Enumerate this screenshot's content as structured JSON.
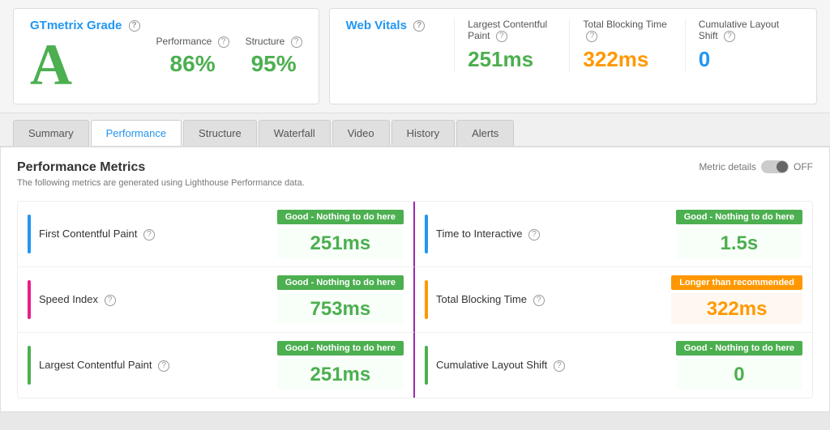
{
  "app": {
    "title": "GTmetrix"
  },
  "topSection": {
    "gradeTitle": "GTmetrix Grade",
    "gradeLetter": "A",
    "performanceLabel": "Performance",
    "performanceValue": "86%",
    "structureLabel": "Structure",
    "structureValue": "95%",
    "webVitalsTitle": "Web Vitals",
    "lcpLabel": "Largest Contentful Paint",
    "lcpValue": "251ms",
    "tbtLabel": "Total Blocking Time",
    "tbtValue": "322ms",
    "clsLabel": "Cumulative Layout Shift",
    "clsValue": "0"
  },
  "tabs": [
    {
      "label": "Summary",
      "active": false
    },
    {
      "label": "Performance",
      "active": true
    },
    {
      "label": "Structure",
      "active": false
    },
    {
      "label": "Waterfall",
      "active": false
    },
    {
      "label": "Video",
      "active": false
    },
    {
      "label": "History",
      "active": false
    },
    {
      "label": "Alerts",
      "active": false
    }
  ],
  "performanceMetrics": {
    "sectionTitle": "Performance Metrics",
    "sectionSubtitle": "The following metrics are generated using Lighthouse Performance data.",
    "metricDetailsLabel": "Metric details",
    "toggleState": "OFF",
    "metrics": [
      {
        "name": "First Contentful Paint",
        "badgeLabel": "Good - Nothing to do here",
        "badgeType": "green",
        "value": "251ms",
        "valueType": "green",
        "borderColor": "blue"
      },
      {
        "name": "Time to Interactive",
        "badgeLabel": "Good - Nothing to do here",
        "badgeType": "green",
        "value": "1.5s",
        "valueType": "green",
        "borderColor": "blue"
      },
      {
        "name": "Speed Index",
        "badgeLabel": "Good - Nothing to do here",
        "badgeType": "green",
        "value": "753ms",
        "valueType": "green",
        "borderColor": "pink"
      },
      {
        "name": "Total Blocking Time",
        "badgeLabel": "Longer than recommended",
        "badgeType": "orange",
        "value": "322ms",
        "valueType": "orange",
        "borderColor": "orange"
      },
      {
        "name": "Largest Contentful Paint",
        "badgeLabel": "Good - Nothing to do here",
        "badgeType": "green",
        "value": "251ms",
        "valueType": "green",
        "borderColor": "green"
      },
      {
        "name": "Cumulative Layout Shift",
        "badgeLabel": "Good - Nothing to do here",
        "badgeType": "green",
        "value": "0",
        "valueType": "green",
        "borderColor": "green"
      }
    ]
  },
  "icons": {
    "info": "?",
    "toggleOff": "OFF"
  }
}
